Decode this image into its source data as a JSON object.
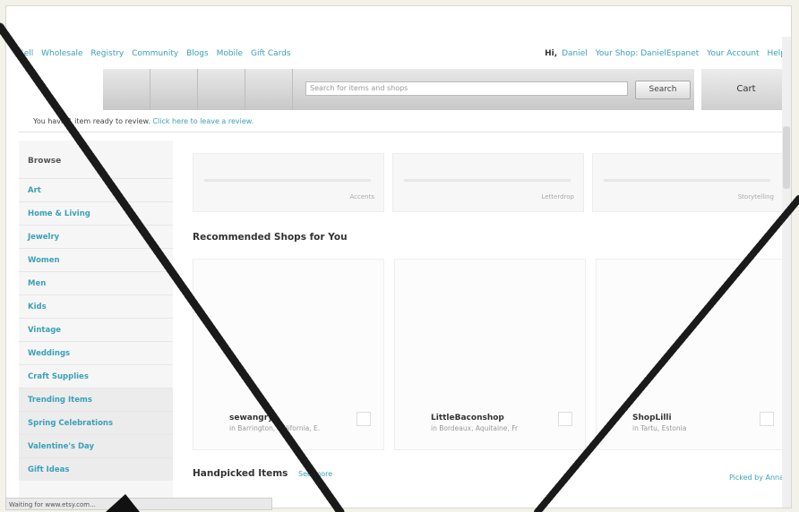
{
  "topnav": {
    "items": [
      "Sell",
      "Wholesale",
      "Registry",
      "Community",
      "Blogs",
      "Mobile",
      "Gift Cards"
    ]
  },
  "usernav": {
    "greeting": "Hi,",
    "user": "Daniel",
    "links": [
      "Your Shop: DanielEspanet",
      "Your Account",
      "Help"
    ]
  },
  "search": {
    "placeholder": "Search for items and shops",
    "button": "Search"
  },
  "cart": {
    "label": "Cart"
  },
  "notice": {
    "text": "You have 1 item ready to review.",
    "link": "Click here to leave a review."
  },
  "sidebar": {
    "heading": "Browse",
    "items": [
      "Art",
      "Home & Living",
      "Jewelry",
      "Women",
      "Men",
      "Kids",
      "Vintage",
      "Weddings",
      "Craft Supplies",
      "Trending Items",
      "Spring Celebrations",
      "Valentine's Day",
      "Gift Ideas"
    ]
  },
  "featured": {
    "labels": [
      "Accents",
      "Letterdrop",
      "Storytelling"
    ]
  },
  "recommended": {
    "title": "Recommended Shops for You",
    "shops": [
      {
        "name": "sewangry",
        "location": "in Barrington, California, E."
      },
      {
        "name": "LittleBaconshop",
        "location": "in Bordeaux, Aquitaine, Fr"
      },
      {
        "name": "ShopLilli",
        "location": "in Tartu, Estonia"
      }
    ]
  },
  "handpicked": {
    "title": "Handpicked Items",
    "see_more": "See more",
    "picked_by": "Picked by Anna"
  },
  "statusbar": {
    "text": "Waiting for www.etsy.com..."
  },
  "colors": {
    "accent": "#3aa0b8",
    "strokes": "#1a1a1a"
  }
}
